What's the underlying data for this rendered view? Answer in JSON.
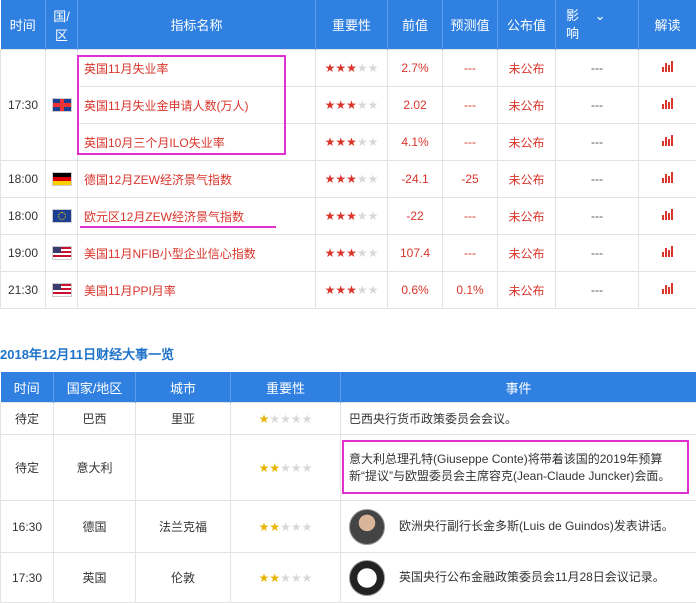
{
  "table1": {
    "headers": [
      "时间",
      "国/区",
      "指标名称",
      "重要性",
      "前值",
      "预测值",
      "公布值",
      "影响",
      "解读"
    ],
    "impact_top": "影",
    "impact_bottom": "响",
    "rows": [
      {
        "time": "17:30",
        "flag": "uk-flag-icon",
        "name": "英国11月失业率",
        "stars": 3,
        "prev": "2.7%",
        "forecast": "---",
        "published": "未公布",
        "impact": "---"
      },
      {
        "time": "",
        "flag": "",
        "name": "英国11月失业金申请人数(万人)",
        "stars": 3,
        "prev": "2.02",
        "forecast": "---",
        "published": "未公布",
        "impact": "---"
      },
      {
        "time": "",
        "flag": "",
        "name": "英国10月三个月ILO失业率",
        "stars": 3,
        "prev": "4.1%",
        "forecast": "---",
        "published": "未公布",
        "impact": "---"
      },
      {
        "time": "18:00",
        "flag": "germany-flag-icon",
        "name": "德国12月ZEW经济景气指数",
        "stars": 3,
        "prev": "-24.1",
        "forecast": "-25",
        "published": "未公布",
        "impact": "---"
      },
      {
        "time": "18:00",
        "flag": "eu-flag-icon",
        "name": "欧元区12月ZEW经济景气指数",
        "stars": 3,
        "prev": "-22",
        "forecast": "---",
        "published": "未公布",
        "impact": "---"
      },
      {
        "time": "19:00",
        "flag": "us-flag-icon",
        "name": "美国11月NFIB小型企业信心指数",
        "stars": 3,
        "prev": "107.4",
        "forecast": "---",
        "published": "未公布",
        "impact": "---"
      },
      {
        "time": "21:30",
        "flag": "us-flag-icon",
        "name": "美国11月PPI月率",
        "stars": 3,
        "prev": "0.6%",
        "forecast": "0.1%",
        "published": "未公布",
        "impact": "---"
      }
    ]
  },
  "section_title": "2018年12月11日财经大事一览",
  "table2": {
    "headers": [
      "时间",
      "国家/地区",
      "城市",
      "重要性",
      "事件"
    ],
    "rows": [
      {
        "time": "待定",
        "country": "巴西",
        "city": "里亚",
        "stars": 1,
        "event": "巴西央行货币政策委员会会议。"
      },
      {
        "time": "待定",
        "country": "意大利",
        "city": "",
        "stars": 2,
        "event": "意大利总理孔特(Giuseppe Conte)将带着该国的2019年预算新“提议”与欧盟委员会主席容克(Jean-Claude Juncker)会面。"
      },
      {
        "time": "16:30",
        "country": "德国",
        "city": "法兰克福",
        "stars": 2,
        "event": "欧洲央行副行长金多斯(Luis de Guindos)发表讲话。"
      },
      {
        "time": "17:30",
        "country": "英国",
        "city": "伦敦",
        "stars": 2,
        "event": "英国央行公布金融政策委员会11月28日会议记录。"
      }
    ]
  },
  "colors": {
    "header_blue": "#2f80e0",
    "red": "#d9352b",
    "highlight": "#e030d0",
    "title_blue": "#1f73c8"
  }
}
